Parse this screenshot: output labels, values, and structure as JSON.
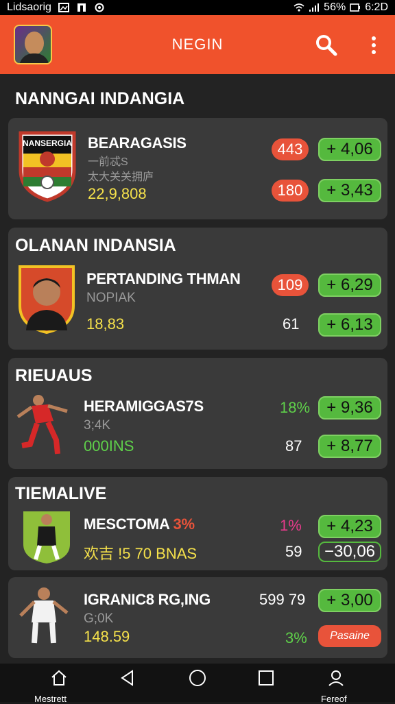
{
  "status_bar": {
    "carrier": "Lidsaorig",
    "battery": "56%",
    "time": "6:2D"
  },
  "app_bar": {
    "title": "NEGIN"
  },
  "sections": [
    {
      "title": "NANNGAI INDANGIA",
      "shield_text": "NANSERGIA",
      "name": "BEARAGASIS",
      "sub1": "一前忒S",
      "sub2": "太大关关拥庐",
      "value": "22,9,808",
      "row1_badge": "443",
      "row1_change": "+ 4,06",
      "row2_badge": "180",
      "row2_change": "+ 3,43"
    },
    {
      "title": "OLANAN INDANSIA",
      "name": "PERTANDING THMAN",
      "sub1": "NOPIAK",
      "value": "18,83",
      "row1_badge": "109",
      "row1_change": "+ 6,29",
      "row2_num": "61",
      "row2_change": "+ 6,13"
    },
    {
      "title": "RIEUAUS",
      "name": "HERAMIGGAS7S",
      "sub1": "3;4K",
      "value": "000INS",
      "row1_pct": "18%",
      "row1_change": "+ 9,36",
      "row2_num": "87",
      "row2_change": "+ 8,77"
    },
    {
      "title": "TIEMALIVE",
      "name": "MESCTOMA",
      "name_pct": "3%",
      "value": "欢吉 !5 70 BNAS",
      "row1_pct": "1%",
      "row1_change": "+ 4,23",
      "row2_num": "59",
      "row2_change": "−30,06"
    },
    {
      "name": "IGRANIC8 RG,ING",
      "sub1": "G;0K",
      "value": "148.59",
      "row1_num": "599 79",
      "row1_change": "+ 3,00",
      "row2_pct": "3%",
      "row2_action": "Pasaine"
    }
  ],
  "nav": {
    "home_label": "Mestrett",
    "profile_label": "Fereof"
  },
  "colors": {
    "app_bar": "#f0522c",
    "accent_green": "#55b93e",
    "badge_red": "#e8533a",
    "value_yellow": "#f5e14b",
    "card_bg": "#3a3a3a",
    "page_bg": "#232323"
  },
  "icons": {
    "search": "search-icon",
    "menu": "more-vertical-icon",
    "home": "home-icon",
    "back": "back-icon",
    "circle": "home-circle-icon",
    "recent": "recent-apps-icon",
    "profile": "profile-icon"
  }
}
